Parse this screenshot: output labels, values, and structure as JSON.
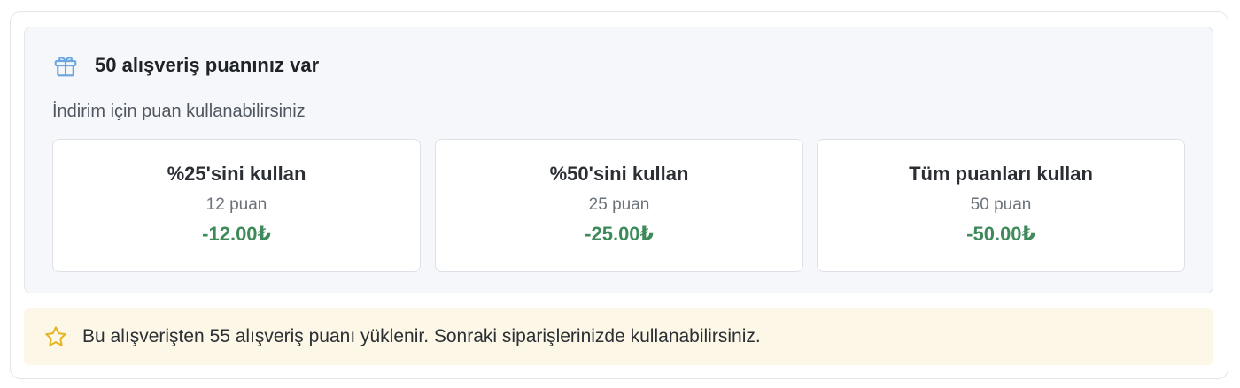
{
  "points": {
    "title": "50 alışveriş puanınız var",
    "subtitle": "İndirim için puan kullanabilirsiniz",
    "icon": "gift-icon",
    "accent_color": "#6aa6e0",
    "options": [
      {
        "label": "%25'sini kullan",
        "points": "12 puan",
        "discount": "-12.00₺"
      },
      {
        "label": "%50'sini kullan",
        "points": "25 puan",
        "discount": "-25.00₺"
      },
      {
        "label": "Tüm puanları kullan",
        "points": "50 puan",
        "discount": "-50.00₺"
      }
    ],
    "discount_color": "#3f8a5a"
  },
  "info": {
    "icon": "star-icon",
    "text": "Bu alışverişten 55 alışveriş puanı yüklenir. Sonraki siparişlerinizde kullanabilirsiniz.",
    "background_color": "#fcf7e6"
  }
}
